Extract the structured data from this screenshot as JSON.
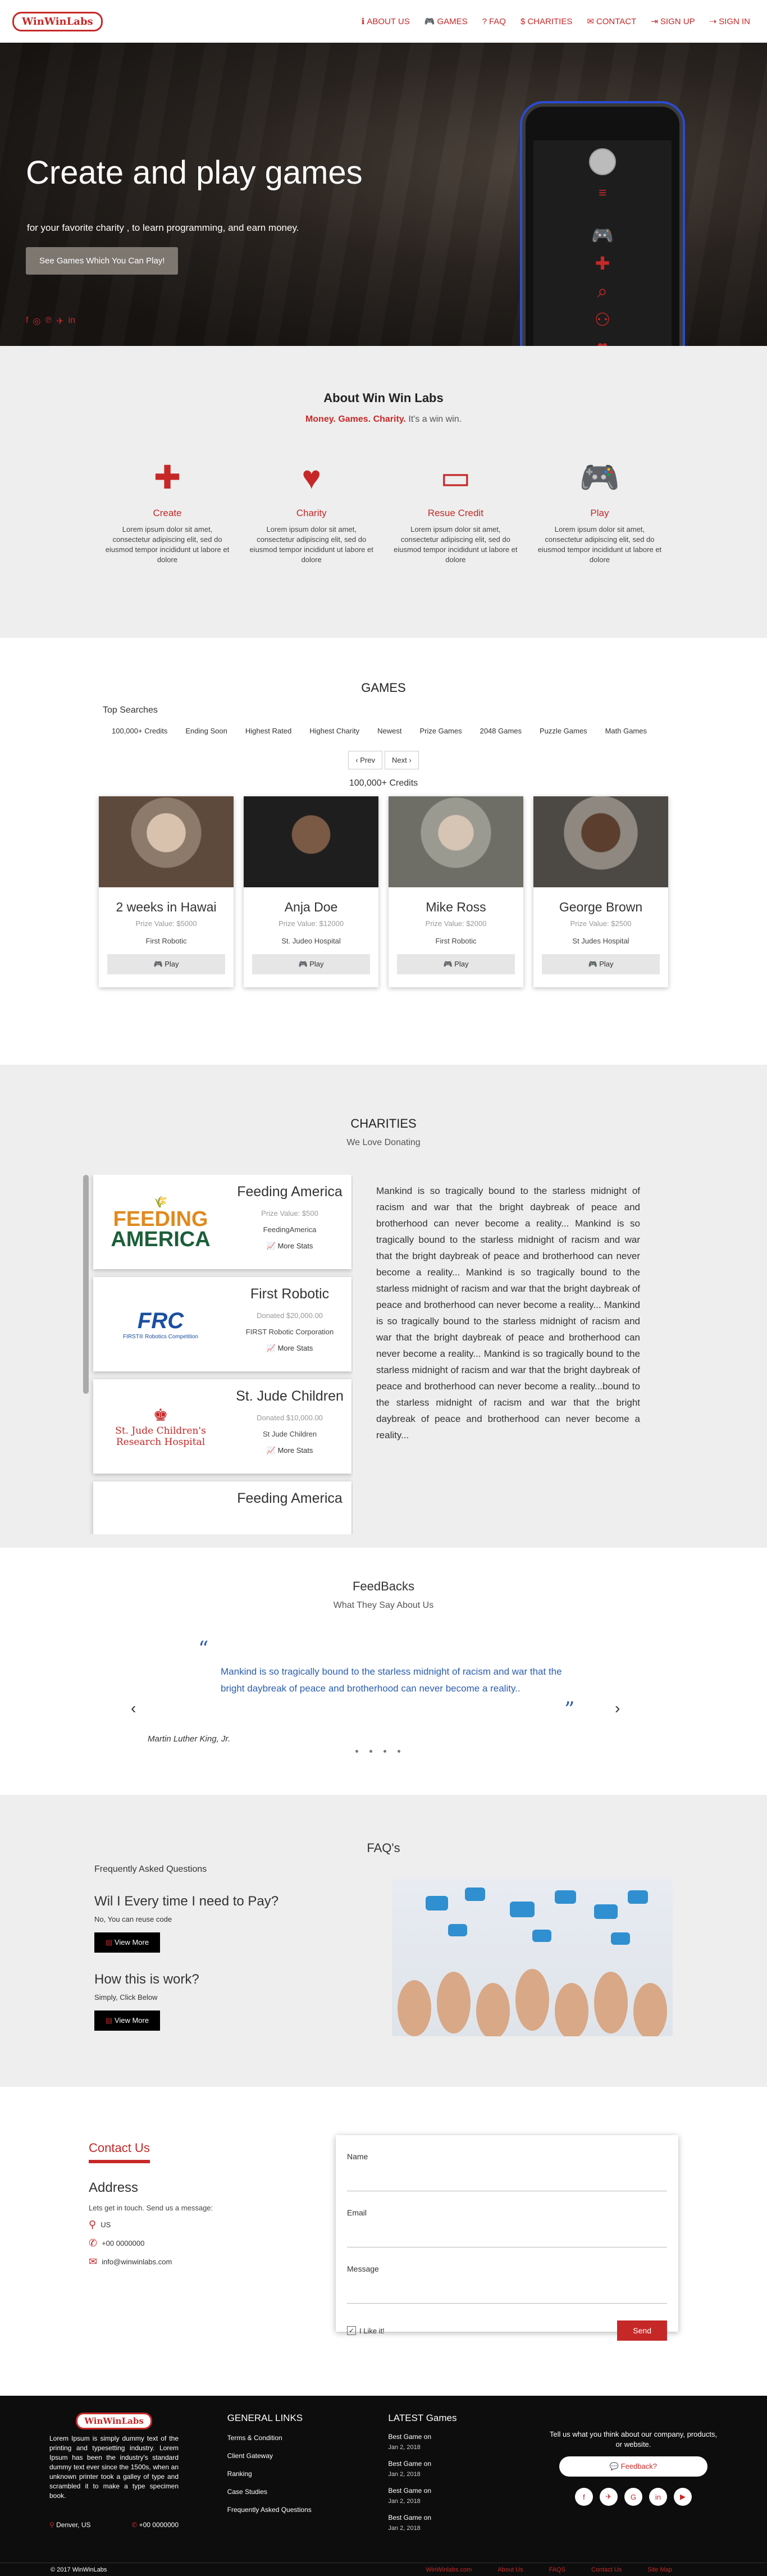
{
  "nav": {
    "logo": "WinWinLabs",
    "links": [
      {
        "icon": "ℹ",
        "label": "ABOUT US"
      },
      {
        "icon": "🎮",
        "label": "GAMES"
      },
      {
        "icon": "?",
        "label": "FAQ"
      },
      {
        "icon": "$",
        "label": "CHARITIES"
      },
      {
        "icon": "✉",
        "label": "CONTACT"
      },
      {
        "icon": "⇥",
        "label": "SIGN UP"
      },
      {
        "icon": "⇢",
        "label": "SIGN IN"
      }
    ]
  },
  "hero": {
    "title": "Create and play games",
    "tagline": "for your favorite charity , to learn programming, and earn money.",
    "cta": "See Games Which You Can Play!",
    "social": [
      "f",
      "◎",
      "℗",
      "✈",
      "in"
    ]
  },
  "about": {
    "title": "About Win Win Labs",
    "subtitle_red": "Money. Games. Charity.",
    "subtitle_rest": " It's a win win.",
    "features": [
      {
        "icon": "✚",
        "title": "Create",
        "text": "Lorem ipsum dolor sit amet, consectetur adipiscing elit, sed do eiusmod tempor incididunt ut labore et dolore"
      },
      {
        "icon": "♥",
        "title": "Charity",
        "text": "Lorem ipsum dolor sit amet, consectetur adipiscing elit, sed do eiusmod tempor incididunt ut labore et dolore"
      },
      {
        "icon": "▭",
        "title": "Resue Credit",
        "text": "Lorem ipsum dolor sit amet, consectetur adipiscing elit, sed do eiusmod tempor incididunt ut labore et dolore"
      },
      {
        "icon": "🎮",
        "title": "Play",
        "text": "Lorem ipsum dolor sit amet, consectetur adipiscing elit, sed do eiusmod tempor incididunt ut labore et dolore"
      }
    ]
  },
  "games": {
    "title": "GAMES",
    "top_searches_label": "Top Searches",
    "chips": [
      "100,000+ Credits",
      "Ending Soon",
      "Highest Rated",
      "Highest Charity",
      "Newest",
      "Prize Games",
      "2048 Games",
      "Puzzle Games",
      "Math Games"
    ],
    "prev": "‹ Prev",
    "next": "Next ›",
    "category_title": "100,000+ Credits",
    "cards": [
      {
        "name": "2 weeks in Hawai",
        "prize": "Prize Value: $5000",
        "org": "First Robotic",
        "play": "🎮 Play",
        "color": "#8c7a6a"
      },
      {
        "name": "Anja Doe",
        "prize": "Prize Value: $12000",
        "org": "St. Judeo Hospital",
        "play": "🎮 Play",
        "color": "#2d2d2d"
      },
      {
        "name": "Mike Ross",
        "prize": "Prize Value: $2000",
        "org": "First Robotic",
        "play": "🎮 Play",
        "color": "#8a8a80"
      },
      {
        "name": "George Brown",
        "prize": "Prize Value: $2500",
        "org": "St Judes Hospital",
        "play": "🎮 Play",
        "color": "#5a5550"
      }
    ]
  },
  "charities": {
    "title": "CHARITIES",
    "subtitle": "We Love Donating",
    "items": [
      {
        "name": "Feeding America",
        "amount": "Prize Value: $500",
        "org": "FeedingAmerica",
        "stats": "📈 More Stats",
        "logo_line1": "FEEDING",
        "logo_line2": "AMERICA"
      },
      {
        "name": "First Robotic",
        "amount": "Donated $20,000.00",
        "org": "FIRST Robotic Corporation",
        "stats": "📈 More Stats",
        "logo_line1": "FRC",
        "logo_line2": "FIRST® Robotics Competition"
      },
      {
        "name": "St. Jude Children",
        "amount": "Donated $10,000.00",
        "org": "St Jude Children",
        "stats": "📈 More Stats",
        "logo_line1": "St. Jude Children's",
        "logo_line2": "Research Hospital"
      },
      {
        "name": "Feeding America",
        "amount": "",
        "org": "",
        "stats": "",
        "logo_line1": "",
        "logo_line2": ""
      }
    ],
    "text": "Mankind is so tragically bound to the starless midnight of racism and war that the bright daybreak of peace and brotherhood can never become a reality... Mankind is so tragically bound to the starless midnight of racism and war that the bright daybreak of peace and brotherhood can never become a reality... Mankind is so tragically bound to the starless midnight of racism and war that the bright daybreak of peace and brotherhood can never become a reality... Mankind is so tragically bound to the starless midnight of racism and war that the bright daybreak of peace and brotherhood can never become a reality... Mankind is so tragically bound to the starless midnight of racism and war that the bright daybreak of peace and brotherhood can never become a reality...bound to the starless midnight of racism and war that the bright daybreak of peace and brotherhood can never become a reality..."
  },
  "feedback": {
    "title": "FeedBacks",
    "subtitle": "What They Say About Us",
    "quote": "Mankind is so tragically bound to the starless midnight of racism and war that the bright daybreak of peace and brotherhood can never become a reality..",
    "author": "Martin Luther King, Jr."
  },
  "faq": {
    "title": "FAQ's",
    "label": "Frequently Asked Questions",
    "items": [
      {
        "q": "Wil I Every time I need to Pay?",
        "a": "No, You can reuse code",
        "btn": "View More"
      },
      {
        "q": "How this is work?",
        "a": "Simply, Click Below",
        "btn": "View More"
      }
    ]
  },
  "contact": {
    "title": "Contact Us",
    "address_title": "Address",
    "tagline": "Lets get in touch. Send us a message:",
    "location": "US",
    "phone": "+00 0000000",
    "email": "info@winwinlabs.com",
    "form": {
      "name": "Name",
      "email": "Email",
      "message": "Message",
      "check": "I Like it!",
      "send": "Send"
    }
  },
  "footer": {
    "logo": "WinWinLabs",
    "about": "Lorem Ipsum is simply dummy text of the printing and typesetting industry. Lorem Ipsum has been the industry's standard dummy text ever since the 1500s, when an unknown printer took a galley of type and scrambled it to make a type specimen book.",
    "location": "Denver, US",
    "phone": "+00 0000000",
    "general_title": "GENERAL LINKS",
    "general_links": [
      "Terms & Condition",
      "Client Gateway",
      "Ranking",
      "Case Studies",
      "Frequently Asked Questions"
    ],
    "latest_title": "LATEST Games",
    "latest": [
      {
        "name": "Best Game on",
        "date": "Jan 2, 2018"
      },
      {
        "name": "Best Game on",
        "date": "Jan 2, 2018"
      },
      {
        "name": "Best Game on",
        "date": "Jan 2, 2018"
      },
      {
        "name": "Best Game on",
        "date": "Jan 2, 2018"
      }
    ],
    "feedback_text": "Tell us what you think about our company, products, or website.",
    "feedback_btn": "Feedback?",
    "copyright": "© 2017 WinWinLabs",
    "bottom_links": [
      "WinWinlabs.com",
      "About Us",
      "FAQS",
      "Contact Us",
      "Site Map"
    ]
  }
}
